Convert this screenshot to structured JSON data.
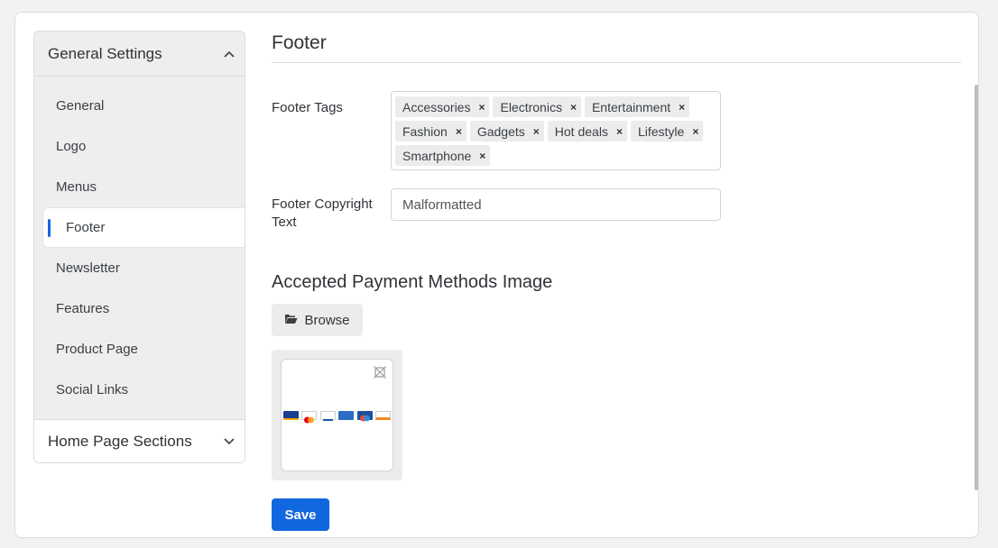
{
  "sidebar": {
    "group1_title": "General Settings",
    "items": [
      {
        "label": "General"
      },
      {
        "label": "Logo"
      },
      {
        "label": "Menus"
      },
      {
        "label": "Footer"
      },
      {
        "label": "Newsletter"
      },
      {
        "label": "Features"
      },
      {
        "label": "Product Page"
      },
      {
        "label": "Social Links"
      }
    ],
    "active_item": "Footer",
    "group2_title": "Home Page Sections"
  },
  "main": {
    "title": "Footer",
    "footer_tags_label": "Footer Tags",
    "tags": [
      "Accessories",
      "Electronics",
      "Entertainment",
      "Fashion",
      "Gadgets",
      "Hot deals",
      "Lifestyle",
      "Smartphone"
    ],
    "tag_remove_glyph": "×",
    "copyright_label": "Footer Copyright Text",
    "copyright_value": "Malformatted",
    "payment_section_title": "Accepted Payment Methods Image",
    "browse_label": "Browse",
    "save_label": "Save"
  },
  "colors": {
    "accent": "#1167e0",
    "background": "#f2f2f2"
  },
  "icons": {
    "group1_chevron": "chevron-up-icon",
    "group2_chevron": "chevron-down-icon",
    "browse": "folder-open-icon",
    "remove_image": "remove-image-icon"
  }
}
